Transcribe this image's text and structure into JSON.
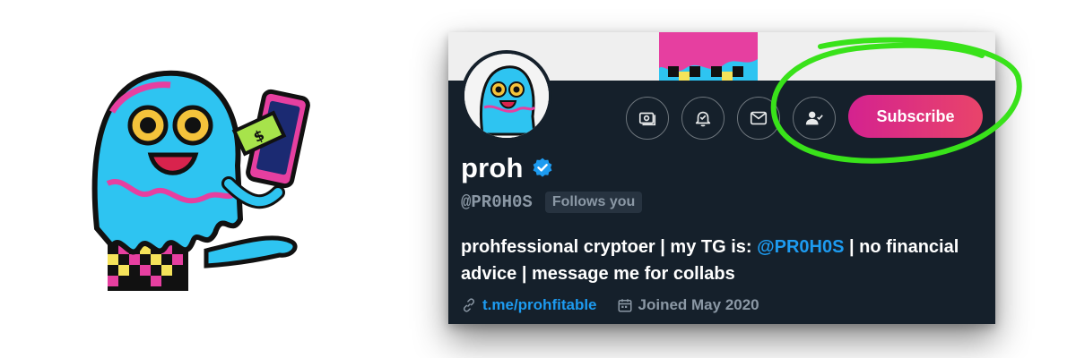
{
  "profile": {
    "name": "proh",
    "handle": "@PR0H0S",
    "follows_badge": "Follows you",
    "bio_part1": "prohfessional cryptoer | my TG is: ",
    "bio_mention": "@PR0H0S",
    "bio_part2": " | no financial advice | message me for collabs",
    "link": "t.me/prohfitable",
    "joined": "Joined May 2020"
  },
  "actions": {
    "subscribe_label": "Subscribe",
    "icons": [
      "money-icon",
      "bell-icon",
      "mail-icon",
      "person-check-icon"
    ]
  },
  "colors": {
    "background": "#15202b",
    "accent_blue": "#1d9bf0",
    "subscribe_gradient_start": "#d4228f",
    "subscribe_gradient_end": "#e9446a",
    "highlight_green": "#39e21a"
  }
}
